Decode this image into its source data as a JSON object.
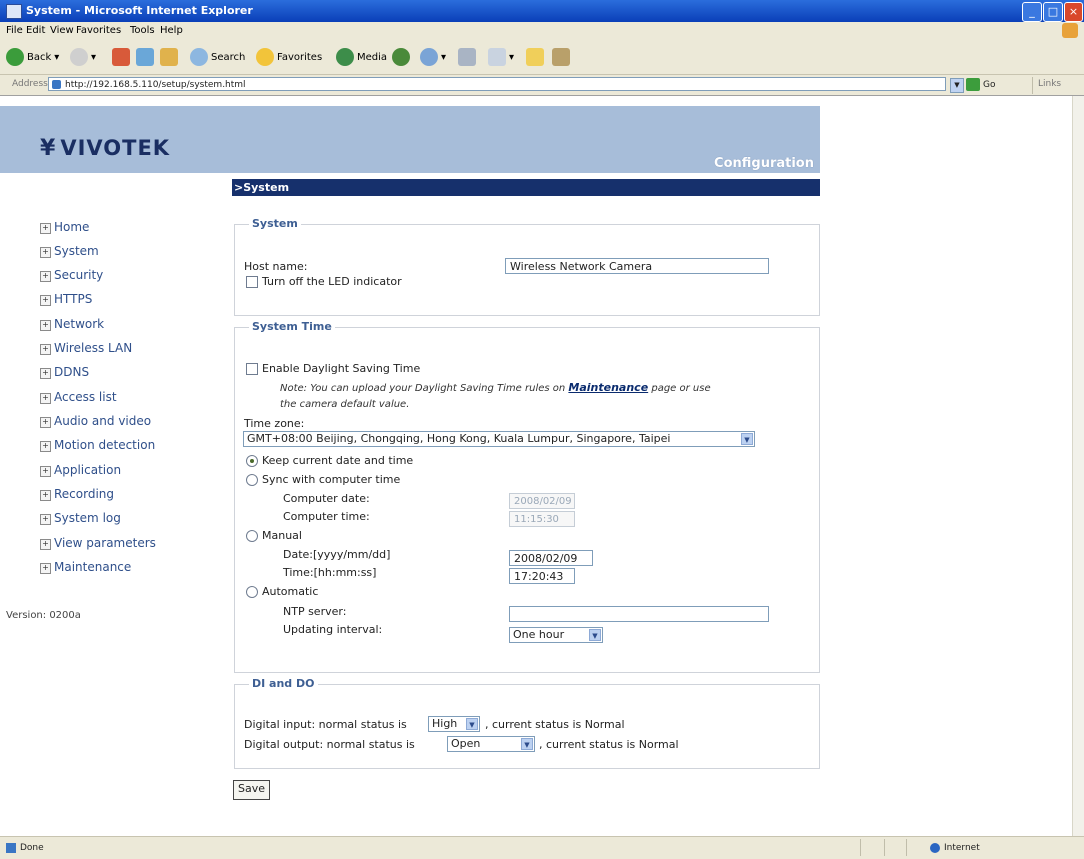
{
  "window": {
    "title": "System - Microsoft Internet Explorer"
  },
  "menu": [
    "File",
    "Edit",
    "View",
    "Favorites",
    "Tools",
    "Help"
  ],
  "toolbar": {
    "back": "Back",
    "search": "Search",
    "favorites": "Favorites",
    "media": "Media"
  },
  "address": {
    "label": "Address",
    "url": "http://192.168.5.110/setup/system.html",
    "go": "Go",
    "links": "Links"
  },
  "header": {
    "logo": "VIVOTEK",
    "configuration": "Configuration"
  },
  "section_title": ">System",
  "sidebar": {
    "items": [
      "Home",
      "System",
      "Security",
      "HTTPS",
      "Network",
      "Wireless LAN",
      "DDNS",
      "Access list",
      "Audio and video",
      "Motion detection",
      "Application",
      "Recording",
      "System log",
      "View parameters",
      "Maintenance"
    ],
    "version": "Version: 0200a"
  },
  "system": {
    "legend": "System",
    "host_label": "Host name:",
    "host_value": "Wireless Network Camera",
    "led_label": "Turn off the LED indicator"
  },
  "time": {
    "legend": "System Time",
    "dst_label": "Enable Daylight Saving Time",
    "note_prefix": "Note: You can upload your Daylight Saving Time rules on",
    "note_link": "Maintenance",
    "note_suffix": "page or use",
    "note_line2": "the camera default value.",
    "tz_label": "Time zone:",
    "tz_value": "GMT+08:00 Beijing, Chongqing, Hong Kong, Kuala Lumpur, Singapore, Taipei",
    "keep_label": "Keep current date and time",
    "sync_label": "Sync with computer time",
    "comp_date_label": "Computer date:",
    "comp_date_value": "2008/02/09",
    "comp_time_label": "Computer time:",
    "comp_time_value": "11:15:30",
    "manual_label": "Manual",
    "date_label": "Date:[yyyy/mm/dd]",
    "date_value": "2008/02/09",
    "time_label": "Time:[hh:mm:ss]",
    "time_value": "17:20:43",
    "auto_label": "Automatic",
    "ntp_label": "NTP server:",
    "ntp_value": "",
    "interval_label": "Updating interval:",
    "interval_value": "One hour"
  },
  "dido": {
    "legend": "DI and DO",
    "di_prefix": "Digital input: normal status is",
    "di_value": "High",
    "di_suffix": ", current status is Normal",
    "do_prefix": "Digital output: normal status is",
    "do_value": "Open",
    "do_suffix": ", current status is Normal"
  },
  "save_label": "Save",
  "status": {
    "left": "Done",
    "zone": "Internet"
  },
  "colors": {
    "header_bg": "#a7bdd9",
    "section_bar": "#16306c",
    "title_bar": "#0a3fb8"
  }
}
